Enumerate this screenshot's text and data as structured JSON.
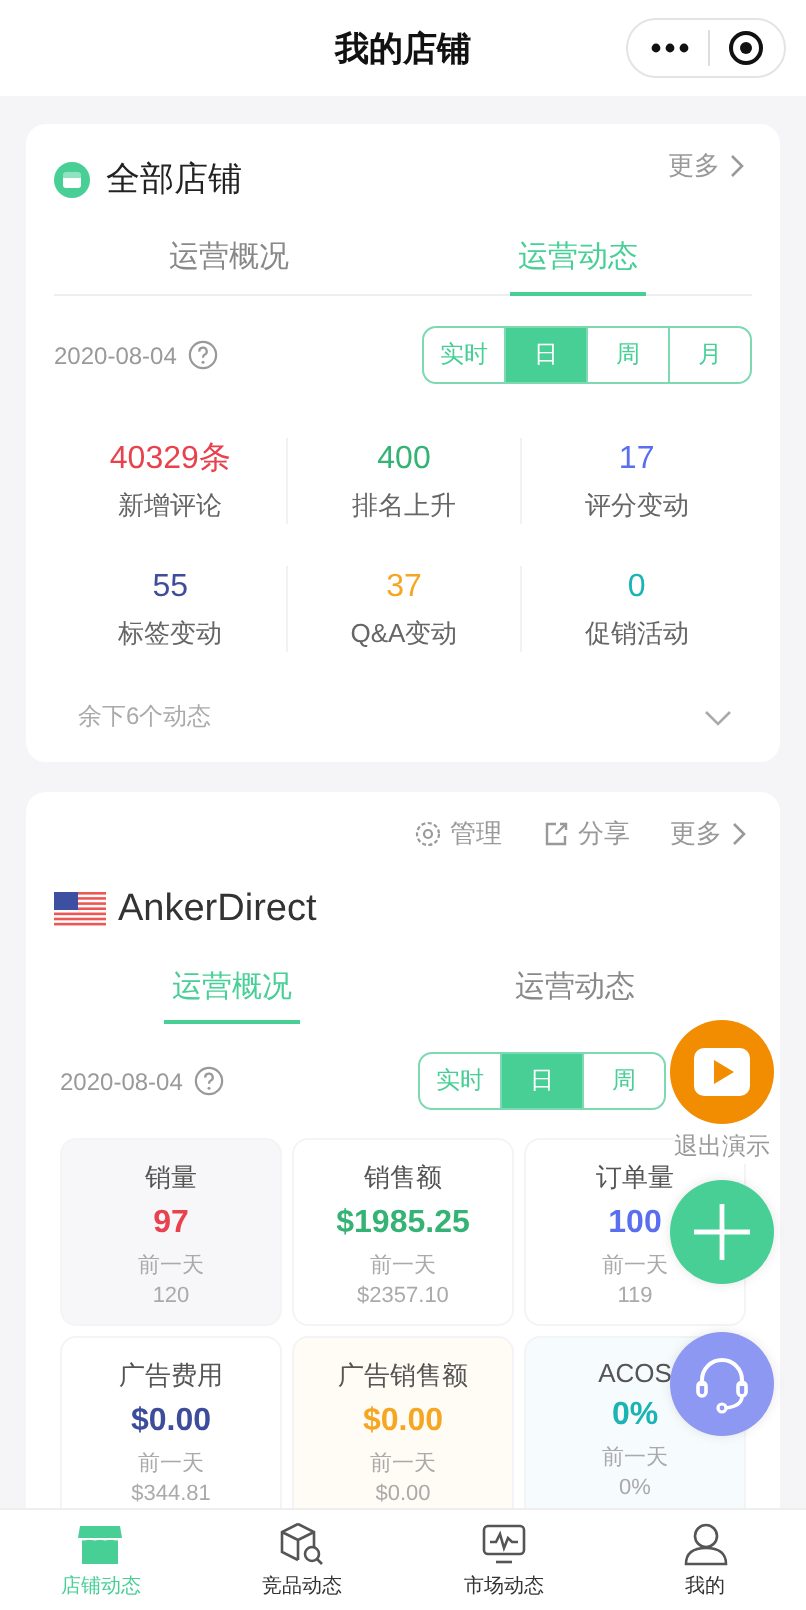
{
  "header": {
    "title": "我的店铺"
  },
  "overview_card": {
    "title": "全部店铺",
    "more": "更多",
    "tabs": [
      {
        "label": "运营概况",
        "selected": false
      },
      {
        "label": "运营动态",
        "selected": true
      }
    ],
    "date": "2020-08-04",
    "periods": [
      {
        "label": "实时",
        "selected": false
      },
      {
        "label": "日",
        "selected": true
      },
      {
        "label": "周",
        "selected": false
      },
      {
        "label": "月",
        "selected": false
      }
    ],
    "stats": [
      {
        "value": "40329条",
        "label": "新增评论",
        "color": "#e8424f"
      },
      {
        "value": "400",
        "label": "排名上升",
        "color": "#35b374"
      },
      {
        "value": "17",
        "label": "评分变动",
        "color": "#5a6ff0"
      },
      {
        "value": "55",
        "label": "标签变动",
        "color": "#3d4d9a"
      },
      {
        "value": "37",
        "label": "Q&A变动",
        "color": "#f5a623"
      },
      {
        "value": "0",
        "label": "促销活动",
        "color": "#1bb3b3"
      }
    ],
    "remaining": "余下6个动态"
  },
  "store_card": {
    "actions": [
      {
        "kind": "manage",
        "label": "管理"
      },
      {
        "kind": "share",
        "label": "分享"
      },
      {
        "kind": "more",
        "label": "更多"
      }
    ],
    "store_name": "AnkerDirect",
    "tabs": [
      {
        "label": "运营概况",
        "selected": true
      },
      {
        "label": "运营动态",
        "selected": false
      }
    ],
    "date": "2020-08-04",
    "periods": [
      {
        "label": "实时",
        "selected": false
      },
      {
        "label": "日",
        "selected": true
      },
      {
        "label": "周",
        "selected": false
      }
    ],
    "metrics": [
      {
        "title": "销量",
        "value": "97",
        "color": "#e8424f",
        "compare_label": "前一天",
        "compare_value": "120"
      },
      {
        "title": "销售额",
        "value": "$1985.25",
        "color": "#35b374",
        "compare_label": "前一天",
        "compare_value": "$2357.10"
      },
      {
        "title": "订单量",
        "value": "100",
        "color": "#5a6ff0",
        "compare_label": "前一天",
        "compare_value": "119"
      },
      {
        "title": "广告费用",
        "value": "$0.00",
        "color": "#3d4d9a",
        "compare_label": "前一天",
        "compare_value": "$344.81"
      },
      {
        "title": "广告销售额",
        "value": "$0.00",
        "color": "#f5a623",
        "compare_label": "前一天",
        "compare_value": "$0.00"
      },
      {
        "title": "ACOS",
        "value": "0%",
        "color": "#1bb3b3",
        "compare_label": "前一天",
        "compare_value": "0%"
      }
    ]
  },
  "floating": {
    "demo_exit": "退出演示"
  },
  "bottom_nav": [
    {
      "kind": "store",
      "label": "店铺动态",
      "selected": true
    },
    {
      "kind": "product",
      "label": "竞品动态",
      "selected": false
    },
    {
      "kind": "market",
      "label": "市场动态",
      "selected": false
    },
    {
      "kind": "me",
      "label": "我的",
      "selected": false
    }
  ]
}
